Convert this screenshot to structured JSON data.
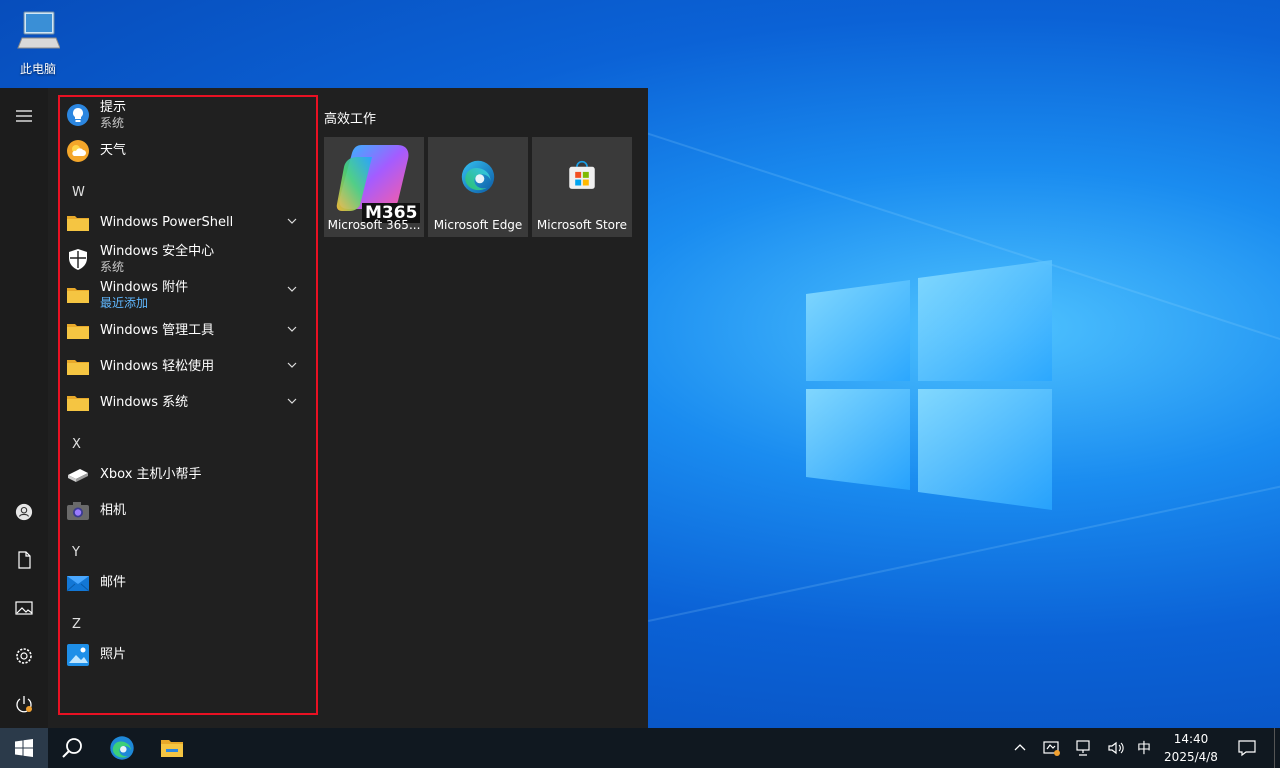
{
  "desktop": {
    "icons": [
      {
        "label": "此电脑",
        "icon": "this-pc-icon"
      }
    ]
  },
  "start_menu": {
    "rail": [
      "hamburger-menu-icon",
      "user-account-icon",
      "documents-icon",
      "pictures-icon",
      "settings-icon",
      "power-icon"
    ],
    "apps": [
      {
        "name": "提示",
        "sub": "系统",
        "icon": "tips-bulb-icon"
      },
      {
        "name": "天气",
        "icon": "weather-icon"
      },
      {
        "letter": "W"
      },
      {
        "name": "Windows PowerShell",
        "icon": "folder-icon",
        "expandable": true
      },
      {
        "name": "Windows 安全中心",
        "sub": "系统",
        "icon": "windows-security-shield-icon"
      },
      {
        "name": "Windows 附件",
        "sub": "最近添加",
        "sub_new": true,
        "icon": "folder-icon",
        "expandable": true
      },
      {
        "name": "Windows 管理工具",
        "icon": "folder-icon",
        "expandable": true
      },
      {
        "name": "Windows 轻松使用",
        "icon": "folder-icon",
        "expandable": true
      },
      {
        "name": "Windows 系统",
        "icon": "folder-icon",
        "expandable": true
      },
      {
        "letter": "X"
      },
      {
        "name": "Xbox 主机小帮手",
        "icon": "xbox-console-icon"
      },
      {
        "name": "相机",
        "icon": "camera-icon"
      },
      {
        "letter": "Y"
      },
      {
        "name": "邮件",
        "icon": "mail-icon"
      },
      {
        "letter": "Z"
      },
      {
        "name": "照片",
        "icon": "photos-icon"
      }
    ],
    "tile_group": {
      "title": "高效工作",
      "tiles": [
        {
          "label": "Microsoft 365...",
          "badge": "M365",
          "icon": "microsoft-365-copilot-icon"
        },
        {
          "label": "Microsoft Edge",
          "icon": "edge-icon"
        },
        {
          "label": "Microsoft Store",
          "icon": "store-icon"
        }
      ]
    }
  },
  "taskbar": {
    "pinned": [
      "start-windows-icon",
      "search-icon",
      "edge-icon",
      "file-explorer-icon"
    ],
    "tray": {
      "ime": "中",
      "time": "14:40",
      "date": "2025/4/8"
    }
  },
  "colors": {
    "start_bg": "#202020",
    "highlight_border": "#e81123",
    "accent_blue": "#60b8ff",
    "folder_yellow": "#f5c542"
  }
}
